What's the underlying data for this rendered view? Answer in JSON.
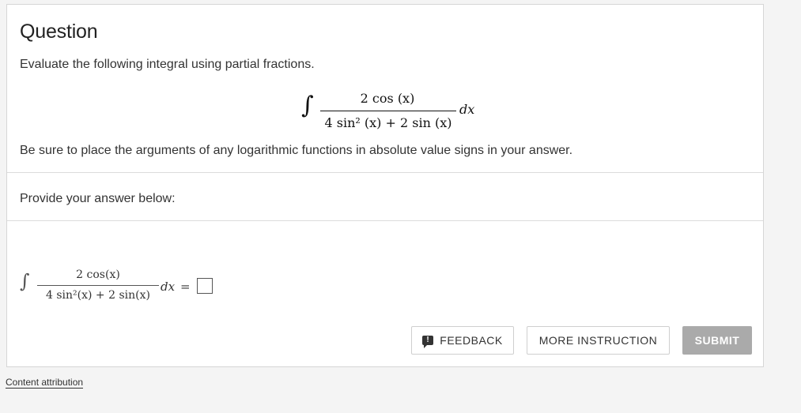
{
  "question": {
    "title": "Question",
    "prompt": "Evaluate the following integral using partial fractions.",
    "integral": {
      "sign": "∫",
      "numerator": "2 cos (x)",
      "denominator": "4 sin² (x) + 2 sin (x)",
      "differential": "dx"
    },
    "note": "Be sure to place the arguments of any logarithmic functions in absolute value signs in your answer."
  },
  "answer": {
    "label": "Provide your answer below:",
    "integral": {
      "sign": "∫",
      "numerator": "2 cos(x)",
      "denominator": "4 sin²(x) + 2 sin(x)",
      "differential": "dx",
      "equals": "="
    }
  },
  "buttons": {
    "feedback": "FEEDBACK",
    "feedback_icon": "!",
    "more_instruction": "MORE INSTRUCTION",
    "submit": "SUBMIT"
  },
  "footer": {
    "attribution": "Content attribution"
  }
}
